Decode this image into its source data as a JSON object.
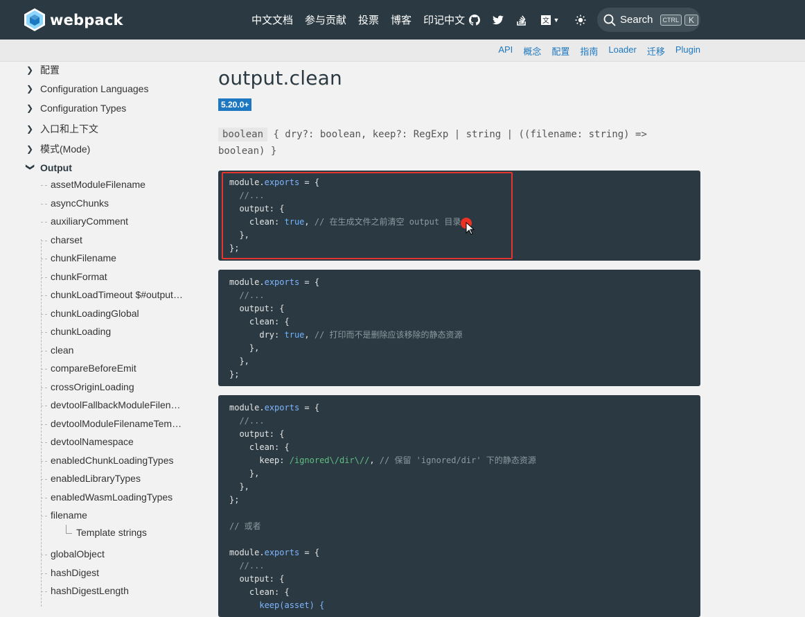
{
  "header": {
    "brand": "webpack",
    "nav": [
      "中文文档",
      "参与贡献",
      "投票",
      "博客",
      "印记中文"
    ],
    "icons": [
      "github-icon",
      "twitter-icon",
      "stackoverflow-icon",
      "language-icon",
      "theme-icon"
    ],
    "search": {
      "label": "Search",
      "key1": "CTRL",
      "key2": "K"
    }
  },
  "subnav": [
    "API",
    "概念",
    "配置",
    "指南",
    "Loader",
    "迁移",
    "Plugin"
  ],
  "sidebar": {
    "top_items": [
      "配置",
      "Configuration Languages",
      "Configuration Types",
      "入口和上下文",
      "模式(Mode)"
    ],
    "active_section": "Output",
    "sub_items": [
      "assetModuleFilename",
      "asyncChunks",
      "auxiliaryComment",
      "charset",
      "chunkFilename",
      "chunkFormat",
      "chunkLoadTimeout $#output-chunkloadtimeout",
      "chunkLoadingGlobal",
      "chunkLoading",
      "clean",
      "compareBeforeEmit",
      "crossOriginLoading",
      "devtoolFallbackModuleFilenameTemplate",
      "devtoolModuleFilenameTemplate",
      "devtoolNamespace",
      "enabledChunkLoadingTypes",
      "enabledLibraryTypes",
      "enabledWasmLoadingTypes",
      "filename"
    ],
    "nested_item": "Template strings",
    "more_items": [
      "globalObject",
      "hashDigest",
      "hashDigestLength"
    ]
  },
  "content": {
    "title": "output.clean",
    "version": "5.20.0+",
    "type_code": "boolean",
    "type_rest": "{ dry?: boolean, keep?: RegExp | string | ((filename: string) => boolean) }",
    "code": {
      "module_exports": "module",
      "dot": ".",
      "exports": "exports",
      "eq_open": " = {",
      "dots": "//...",
      "output": "output: {",
      "clean_key": "clean:",
      "true": "true",
      "comment1": "// 在生成文件之前清空 output 目录",
      "clean_open": "clean: {",
      "dry_key": "dry:",
      "comment2": "// 打印而不是删除应该移除的静态资源",
      "keep_key": "keep:",
      "regex": "/ignored\\/dir\\//",
      "comment3": "// 保留 'ignored/dir' 下的静态资源",
      "or": "// 或者",
      "keep_fn": "keep(asset) {"
    }
  }
}
